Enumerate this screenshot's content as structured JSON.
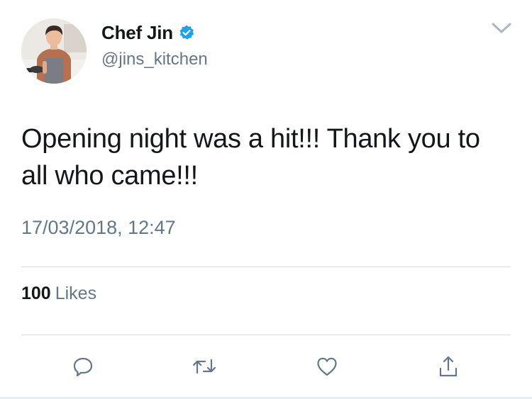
{
  "author": {
    "display_name": "Chef Jin",
    "handle": "@jins_kitchen",
    "verified": true,
    "verified_color": "#1da1f2"
  },
  "tweet": {
    "text": "Opening night was a hit!!! Thank you to all who came!!!",
    "timestamp": "17/03/2018, 12:47"
  },
  "stats": {
    "likes_count": "100",
    "likes_label": "Likes"
  },
  "actions": [
    {
      "icon": "reply-icon"
    },
    {
      "icon": "retweet-icon"
    },
    {
      "icon": "like-icon"
    },
    {
      "icon": "share-icon"
    }
  ],
  "menu": {
    "icon": "chevron-down-icon"
  }
}
